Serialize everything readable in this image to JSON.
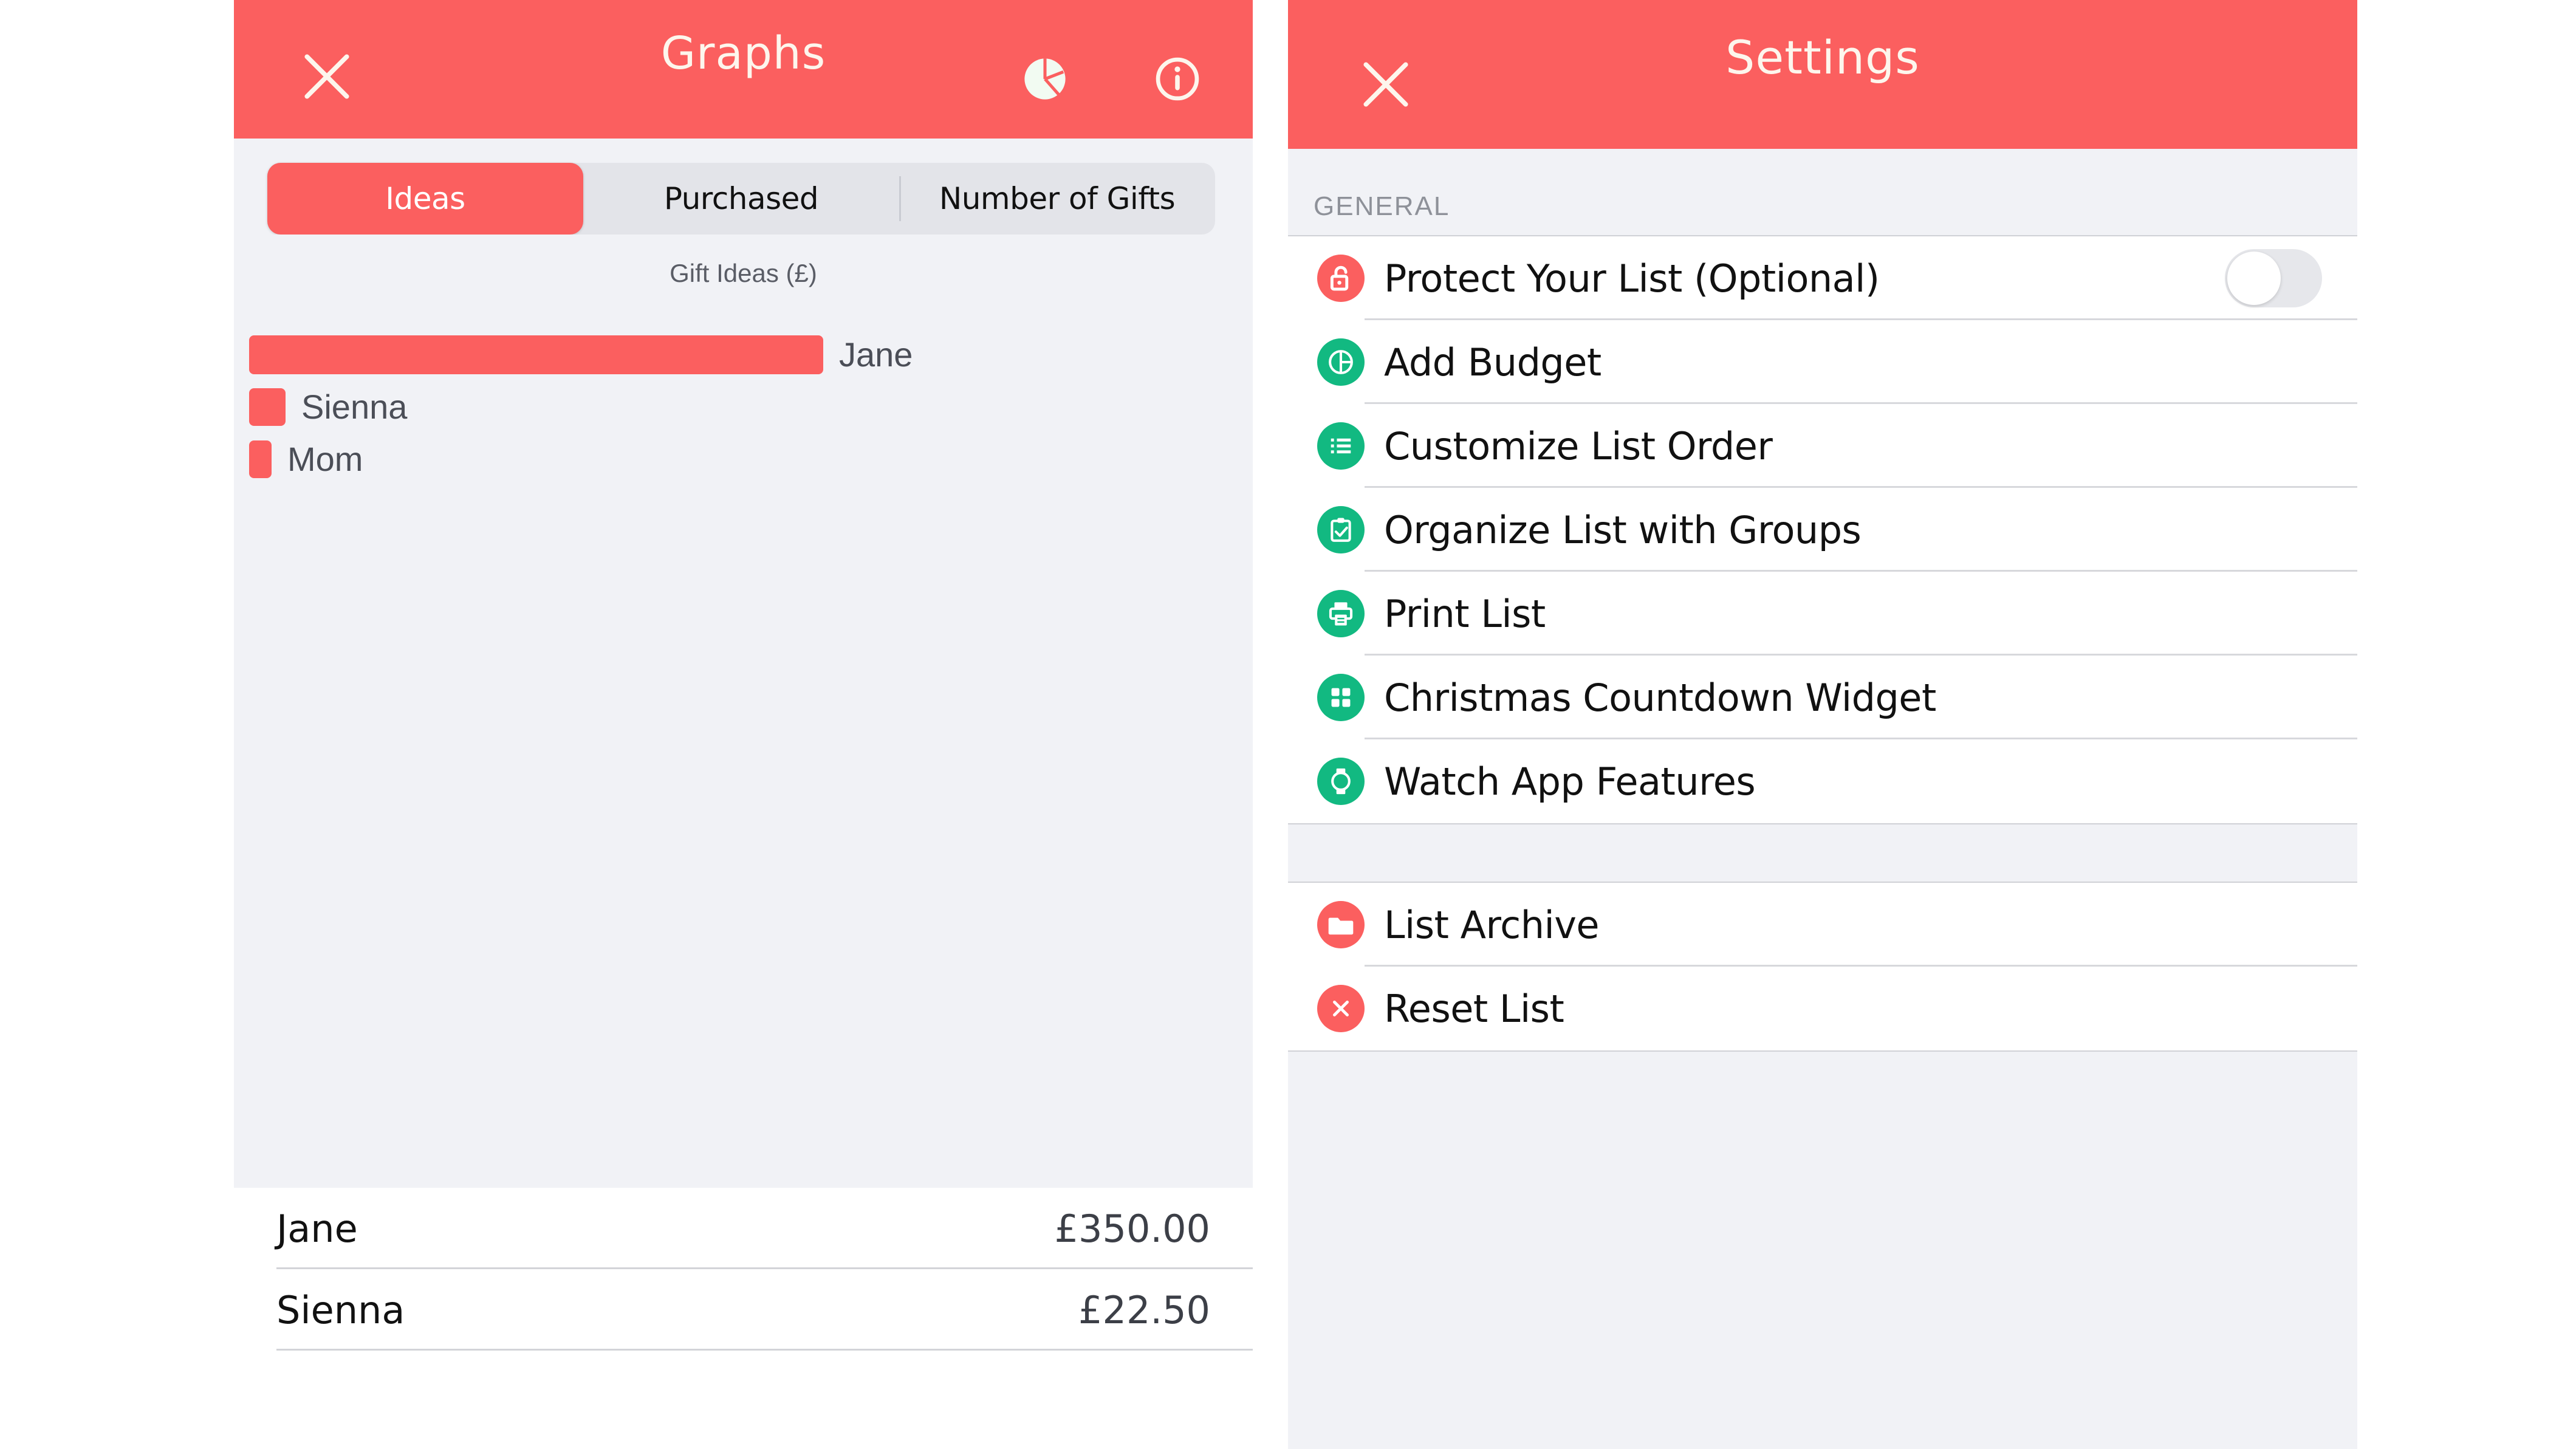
{
  "theme": {
    "coral": "#fb5f5f",
    "green": "#12b981",
    "page_bg": "#f1f2f6",
    "row_bg": "#ffffff"
  },
  "graphs": {
    "navbar": {
      "title": "Graphs",
      "close_icon": "close-icon",
      "pie_icon": "pie-chart-icon",
      "info_icon": "info-circle-icon"
    },
    "segmented": {
      "options": [
        "Ideas",
        "Purchased",
        "Number of Gifts"
      ],
      "selected": "Ideas"
    },
    "chart_data": {
      "type": "bar",
      "orientation": "horizontal",
      "title": "Gift Ideas (£)",
      "xlabel": "",
      "ylabel": "",
      "currency": "£",
      "categories": [
        "Jane",
        "Sienna",
        "Mom"
      ],
      "values": [
        350.0,
        22.5,
        13.0
      ],
      "bar_color": "#fb5f5f",
      "grid": false,
      "legend": false,
      "labels_position": "right-of-bar",
      "bar_pixel_widths": [
        945,
        60,
        37
      ]
    },
    "totals": {
      "rows": [
        {
          "name": "Jane",
          "amount": "£350.00"
        },
        {
          "name": "Sienna",
          "amount": "£22.50"
        }
      ]
    }
  },
  "settings": {
    "navbar": {
      "title": "Settings",
      "close_icon": "close-icon"
    },
    "sections": [
      {
        "header": "GENERAL",
        "rows": [
          {
            "label": "Protect Your List (Optional)",
            "icon": "lock-open-icon",
            "icon_color": "coral",
            "control": "toggle",
            "toggle_on": false
          },
          {
            "label": "Add Budget",
            "icon": "pie-chart-icon",
            "icon_color": "green",
            "control": "none"
          },
          {
            "label": "Customize List Order",
            "icon": "list-icon",
            "icon_color": "green",
            "control": "none"
          },
          {
            "label": "Organize List with Groups",
            "icon": "clipboard-check-icon",
            "icon_color": "green",
            "control": "none"
          },
          {
            "label": "Print List",
            "icon": "printer-icon",
            "icon_color": "green",
            "control": "none"
          },
          {
            "label": "Christmas Countdown Widget",
            "icon": "grid-widget-icon",
            "icon_color": "green",
            "control": "none"
          },
          {
            "label": "Watch App Features",
            "icon": "watch-icon",
            "icon_color": "green",
            "control": "none"
          }
        ]
      },
      {
        "header": "",
        "rows": [
          {
            "label": "List Archive",
            "icon": "folder-icon",
            "icon_color": "coral",
            "control": "none"
          },
          {
            "label": "Reset List",
            "icon": "x-circle-icon",
            "icon_color": "coral",
            "control": "none"
          }
        ]
      }
    ]
  }
}
